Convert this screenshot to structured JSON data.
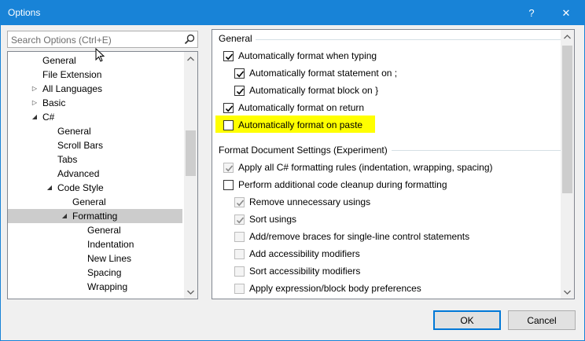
{
  "window": {
    "title": "Options",
    "help_glyph": "?",
    "close_glyph": "✕"
  },
  "search": {
    "placeholder": "Search Options (Ctrl+E)"
  },
  "tree": {
    "items": [
      {
        "label": "General",
        "indent": 0,
        "expander": ""
      },
      {
        "label": "File Extension",
        "indent": 0,
        "expander": ""
      },
      {
        "label": "All Languages",
        "indent": 0,
        "expander": "▷"
      },
      {
        "label": "Basic",
        "indent": 0,
        "expander": "▷"
      },
      {
        "label": "C#",
        "indent": 0,
        "expander": "◢"
      },
      {
        "label": "General",
        "indent": 1,
        "expander": ""
      },
      {
        "label": "Scroll Bars",
        "indent": 1,
        "expander": ""
      },
      {
        "label": "Tabs",
        "indent": 1,
        "expander": ""
      },
      {
        "label": "Advanced",
        "indent": 1,
        "expander": ""
      },
      {
        "label": "Code Style",
        "indent": 1,
        "expander": "◢"
      },
      {
        "label": "General",
        "indent": 2,
        "expander": ""
      },
      {
        "label": "Formatting",
        "indent": 2,
        "expander": "◢",
        "selected": true
      },
      {
        "label": "General",
        "indent": 3,
        "expander": ""
      },
      {
        "label": "Indentation",
        "indent": 3,
        "expander": ""
      },
      {
        "label": "New Lines",
        "indent": 3,
        "expander": ""
      },
      {
        "label": "Spacing",
        "indent": 3,
        "expander": ""
      },
      {
        "label": "Wrapping",
        "indent": 3,
        "expander": ""
      }
    ]
  },
  "general_group": {
    "title": "General",
    "options": [
      {
        "label": "Automatically format when typing",
        "checked": true,
        "enabled": true
      },
      {
        "label": "Automatically format statement on ;",
        "checked": true,
        "enabled": true
      },
      {
        "label": "Automatically format block on }",
        "checked": true,
        "enabled": true
      },
      {
        "label": "Automatically format on return",
        "checked": true,
        "enabled": true
      },
      {
        "label": "Automatically format on paste",
        "checked": false,
        "enabled": true
      }
    ]
  },
  "format_group": {
    "title": "Format Document Settings (Experiment)",
    "options": [
      {
        "label": "Apply all C# formatting rules (indentation, wrapping, spacing)",
        "checked": true,
        "enabled": false
      },
      {
        "label": "Perform additional code cleanup during formatting",
        "checked": false,
        "enabled": true
      },
      {
        "label": "Remove unnecessary usings",
        "checked": true,
        "enabled": false
      },
      {
        "label": "Sort usings",
        "checked": true,
        "enabled": false
      },
      {
        "label": "Add/remove braces for single-line control statements",
        "checked": false,
        "enabled": false
      },
      {
        "label": "Add accessibility modifiers",
        "checked": false,
        "enabled": false
      },
      {
        "label": "Sort accessibility modifiers",
        "checked": false,
        "enabled": false
      },
      {
        "label": "Apply expression/block body preferences",
        "checked": false,
        "enabled": false
      }
    ]
  },
  "buttons": {
    "ok": "OK",
    "cancel": "Cancel"
  },
  "colors": {
    "accent": "#1883d7",
    "highlight": "#ffff00",
    "selection": "#cccccc"
  }
}
